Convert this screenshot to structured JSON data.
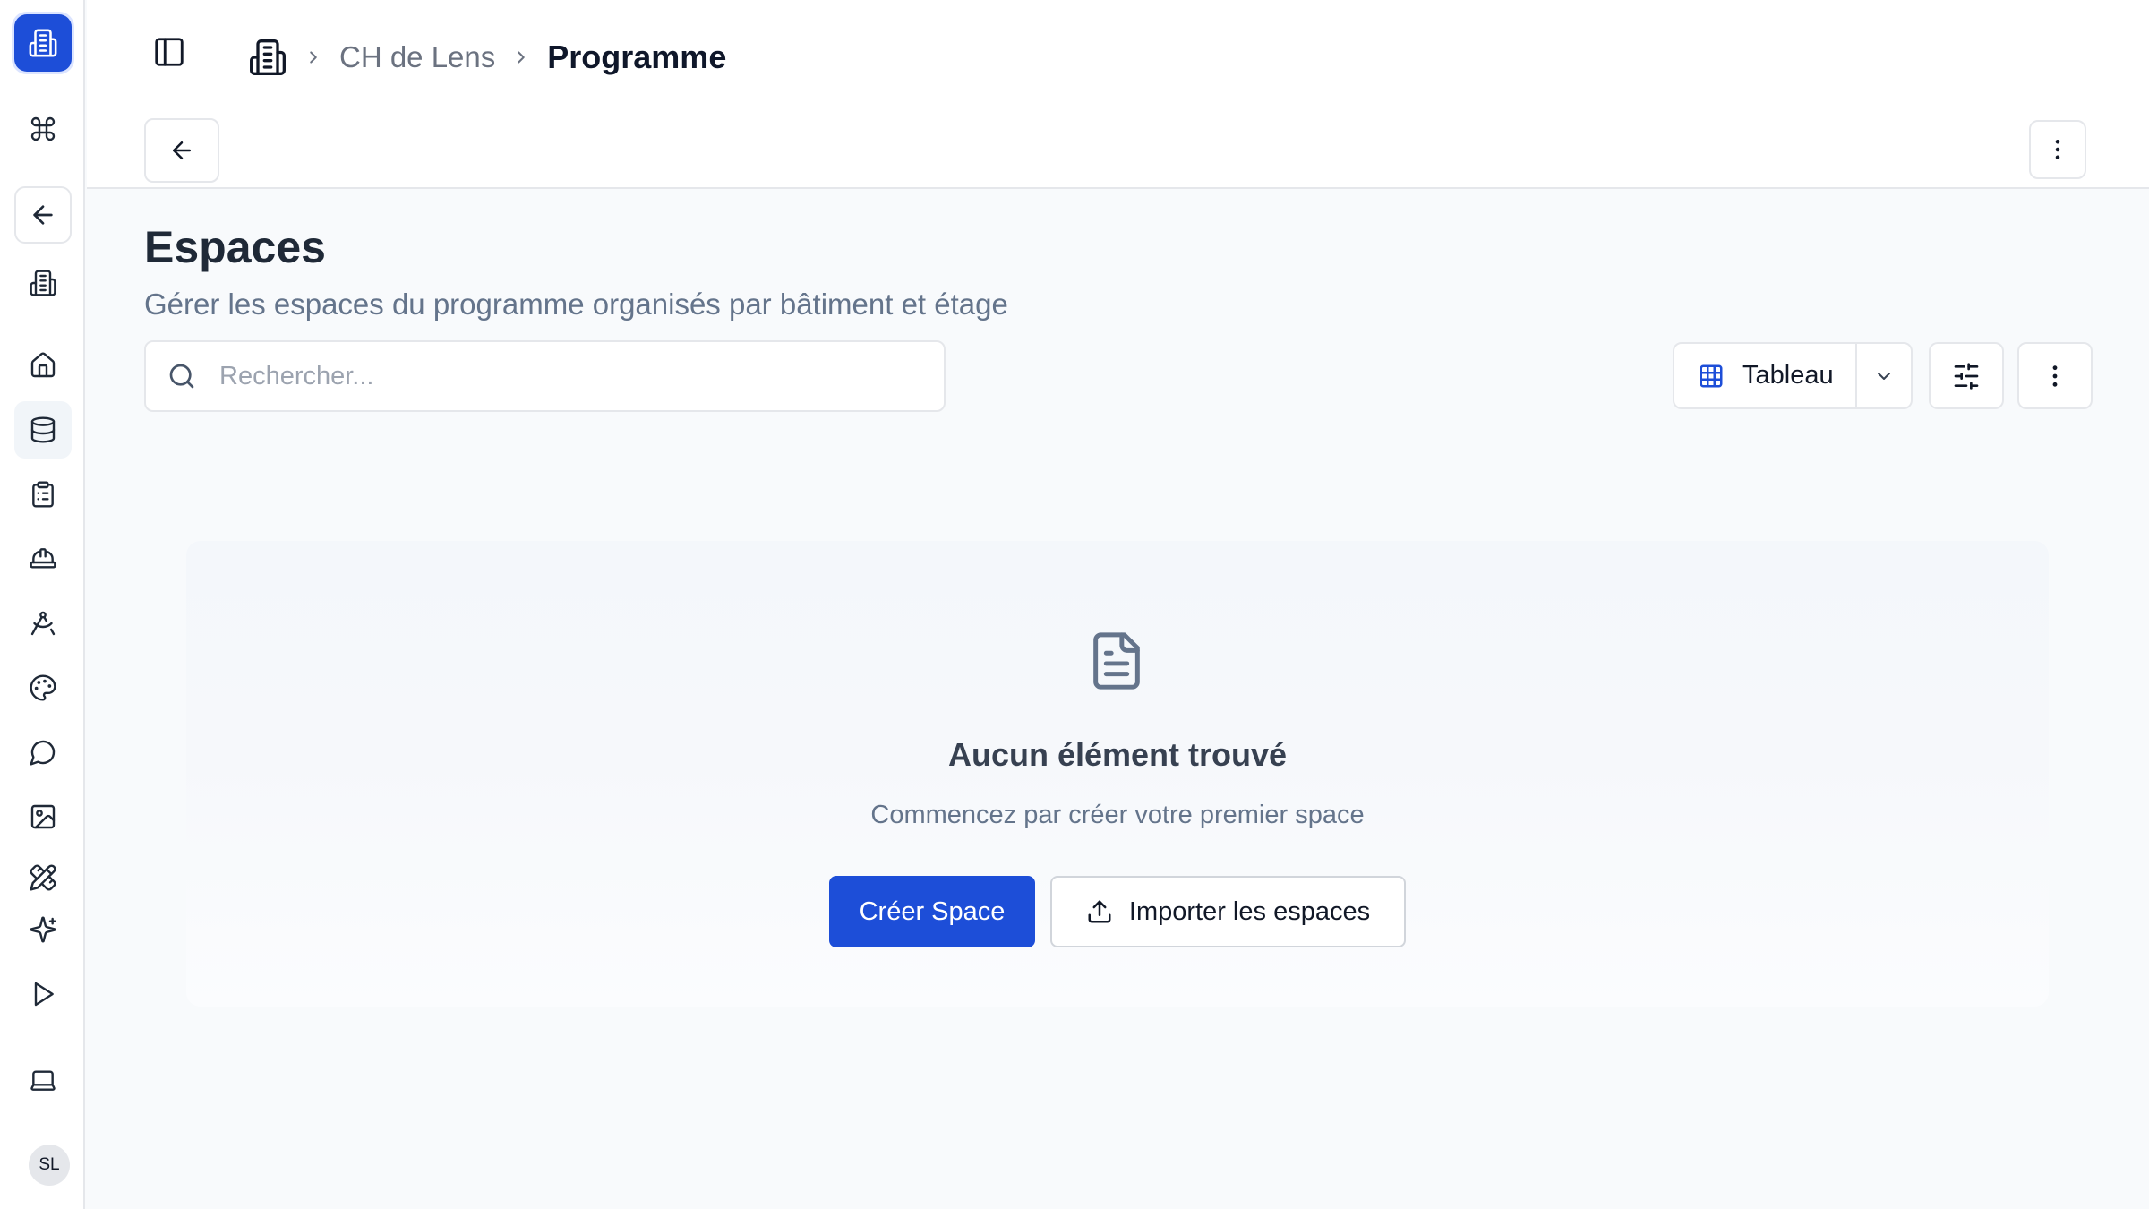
{
  "sidebar": {
    "avatar_initials": "SL",
    "items": [
      {
        "name": "app-logo-icon"
      },
      {
        "name": "command-icon"
      },
      {
        "name": "arrow-left-icon"
      },
      {
        "name": "building-icon"
      },
      {
        "name": "home-icon"
      },
      {
        "name": "database-icon"
      },
      {
        "name": "clipboard-icon"
      },
      {
        "name": "hard-hat-icon"
      },
      {
        "name": "compass-icon"
      },
      {
        "name": "palette-icon"
      },
      {
        "name": "message-icon"
      },
      {
        "name": "image-icon"
      },
      {
        "name": "ruler-pencil-icon"
      },
      {
        "name": "sparkles-icon"
      },
      {
        "name": "play-icon"
      },
      {
        "name": "laptop-icon"
      }
    ]
  },
  "header": {
    "breadcrumb": {
      "parent": "CH de Lens",
      "current": "Programme"
    }
  },
  "main": {
    "title": "Espaces",
    "subtitle": "Gérer les espaces du programme organisés par bâtiment et étage",
    "search": {
      "placeholder": "Rechercher...",
      "value": ""
    },
    "view": {
      "selected": "Tableau"
    }
  },
  "empty_state": {
    "title": "Aucun élément trouvé",
    "description": "Commencez par créer votre premier space",
    "primary_button": "Créer Space",
    "secondary_button": "Importer les espaces"
  },
  "colors": {
    "accent": "#1d4ed8",
    "background": "#f8fafc",
    "border": "#e5e7eb",
    "muted_text": "#64748b"
  }
}
